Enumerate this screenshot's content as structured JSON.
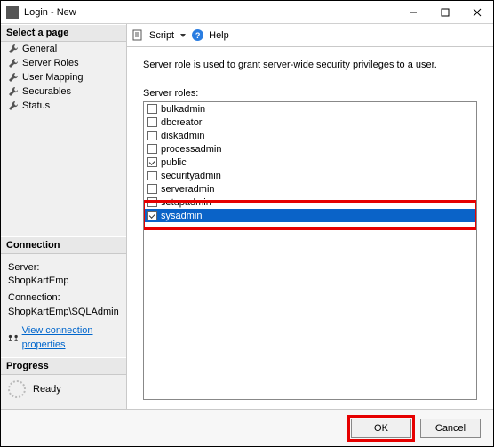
{
  "window": {
    "title": "Login - New"
  },
  "toolbar": {
    "script": "Script",
    "help": "Help"
  },
  "pages": {
    "header": "Select a page",
    "items": [
      "General",
      "Server Roles",
      "User Mapping",
      "Securables",
      "Status"
    ],
    "selected_index": 1
  },
  "connection": {
    "header": "Connection",
    "server_label": "Server:",
    "server_value": "ShopKartEmp",
    "connection_label": "Connection:",
    "connection_value": "ShopKartEmp\\SQLAdmin",
    "view_props": "View connection properties"
  },
  "progress": {
    "header": "Progress",
    "status": "Ready"
  },
  "content": {
    "description": "Server role is used to grant server-wide security privileges to a user.",
    "roles_label": "Server roles:",
    "roles": [
      {
        "name": "bulkadmin",
        "checked": false,
        "selected": false
      },
      {
        "name": "dbcreator",
        "checked": false,
        "selected": false
      },
      {
        "name": "diskadmin",
        "checked": false,
        "selected": false
      },
      {
        "name": "processadmin",
        "checked": false,
        "selected": false
      },
      {
        "name": "public",
        "checked": true,
        "selected": false
      },
      {
        "name": "securityadmin",
        "checked": false,
        "selected": false
      },
      {
        "name": "serveradmin",
        "checked": false,
        "selected": false
      },
      {
        "name": "setupadmin",
        "checked": false,
        "selected": false
      },
      {
        "name": "sysadmin",
        "checked": true,
        "selected": true
      }
    ]
  },
  "footer": {
    "ok": "OK",
    "cancel": "Cancel"
  }
}
